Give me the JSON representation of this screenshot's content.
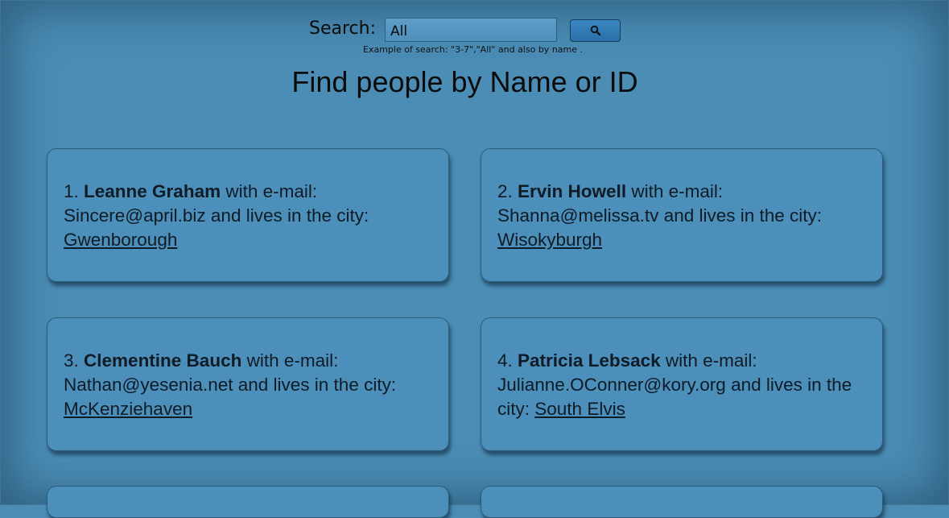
{
  "search": {
    "label": "Search:",
    "value": "All",
    "button_icon": "search-icon",
    "hint": "Example of search: \"3-7\",\"All\" and also by name ."
  },
  "page": {
    "title": "Find people by Name or ID"
  },
  "people": [
    {
      "index": "1.",
      "name": "Leanne Graham",
      "mid1": " with e-mail: ",
      "email": "Sincere@april.biz",
      "mid2": " and lives in the city: ",
      "city": "Gwenborough"
    },
    {
      "index": "2.",
      "name": "Ervin Howell",
      "mid1": " with e-mail: ",
      "email": "Shanna@melissa.tv",
      "mid2": " and lives in the city: ",
      "city": "Wisokyburgh"
    },
    {
      "index": "3.",
      "name": "Clementine Bauch",
      "mid1": " with e-mail: ",
      "email": "Nathan@yesenia.net",
      "mid2": " and lives in the city: ",
      "city": "McKenziehaven"
    },
    {
      "index": "4.",
      "name": "Patricia Lebsack",
      "mid1": " with e-mail: ",
      "email": "Julianne.OConner@kory.org",
      "mid2": " and lives in the city: ",
      "city": "South Elvis"
    }
  ],
  "colors": {
    "background": "#4b8db5",
    "card": "#4c8fba",
    "button": "#2f7ab3"
  }
}
